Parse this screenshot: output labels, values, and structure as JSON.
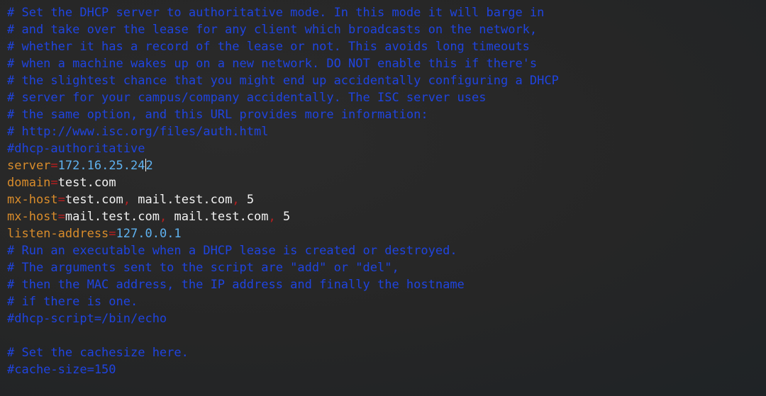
{
  "lines": [
    {
      "type": "comment",
      "text": "# Set the DHCP server to authoritative mode. In this mode it will barge in"
    },
    {
      "type": "comment",
      "text": "# and take over the lease for any client which broadcasts on the network,"
    },
    {
      "type": "comment",
      "text": "# whether it has a record of the lease or not. This avoids long timeouts"
    },
    {
      "type": "comment",
      "text": "# when a machine wakes up on a new network. DO NOT enable this if there's"
    },
    {
      "type": "comment",
      "text": "# the slightest chance that you might end up accidentally configuring a DHCP"
    },
    {
      "type": "comment",
      "text": "# server for your campus/company accidentally. The ISC server uses"
    },
    {
      "type": "comment",
      "text": "# the same option, and this URL provides more information:"
    },
    {
      "type": "comment",
      "text": "# http://www.isc.org/files/auth.html"
    },
    {
      "type": "comment",
      "text": "#dhcp-authoritative"
    },
    {
      "type": "setting",
      "key": "server",
      "eq": "=",
      "value_before_cursor": "172.16.25.24",
      "value_after_cursor": "2"
    },
    {
      "type": "setting",
      "key": "domain",
      "eq": "=",
      "value": "test.com"
    },
    {
      "type": "setting",
      "key": "mx-host",
      "eq": "=",
      "value1": "test.com",
      "sep1": ",",
      "value2": " mail.test.com",
      "sep2": ",",
      "value3": " 5"
    },
    {
      "type": "setting",
      "key": "mx-host",
      "eq": "=",
      "value1": "mail.test.com",
      "sep1": ",",
      "value2": " mail.test.com",
      "sep2": ",",
      "value3": " 5"
    },
    {
      "type": "setting",
      "key": "listen-address",
      "eq": "=",
      "value": "127.0.0.1"
    },
    {
      "type": "comment",
      "text": "# Run an executable when a DHCP lease is created or destroyed."
    },
    {
      "type": "comment",
      "text": "# The arguments sent to the script are \"add\" or \"del\","
    },
    {
      "type": "comment",
      "text": "# then the MAC address, the IP address and finally the hostname"
    },
    {
      "type": "comment",
      "text": "# if there is one."
    },
    {
      "type": "comment",
      "text": "#dhcp-script=/bin/echo"
    },
    {
      "type": "blank",
      "text": ""
    },
    {
      "type": "comment",
      "text": "# Set the cachesize here."
    },
    {
      "type": "comment",
      "text": "#cache-size=150"
    }
  ],
  "colors": {
    "comment": "#1f44e0",
    "key": "#d98c2b",
    "operator": "#b91f1f",
    "value_blue": "#5fb2f0",
    "value_white": "#f2f2f2"
  }
}
